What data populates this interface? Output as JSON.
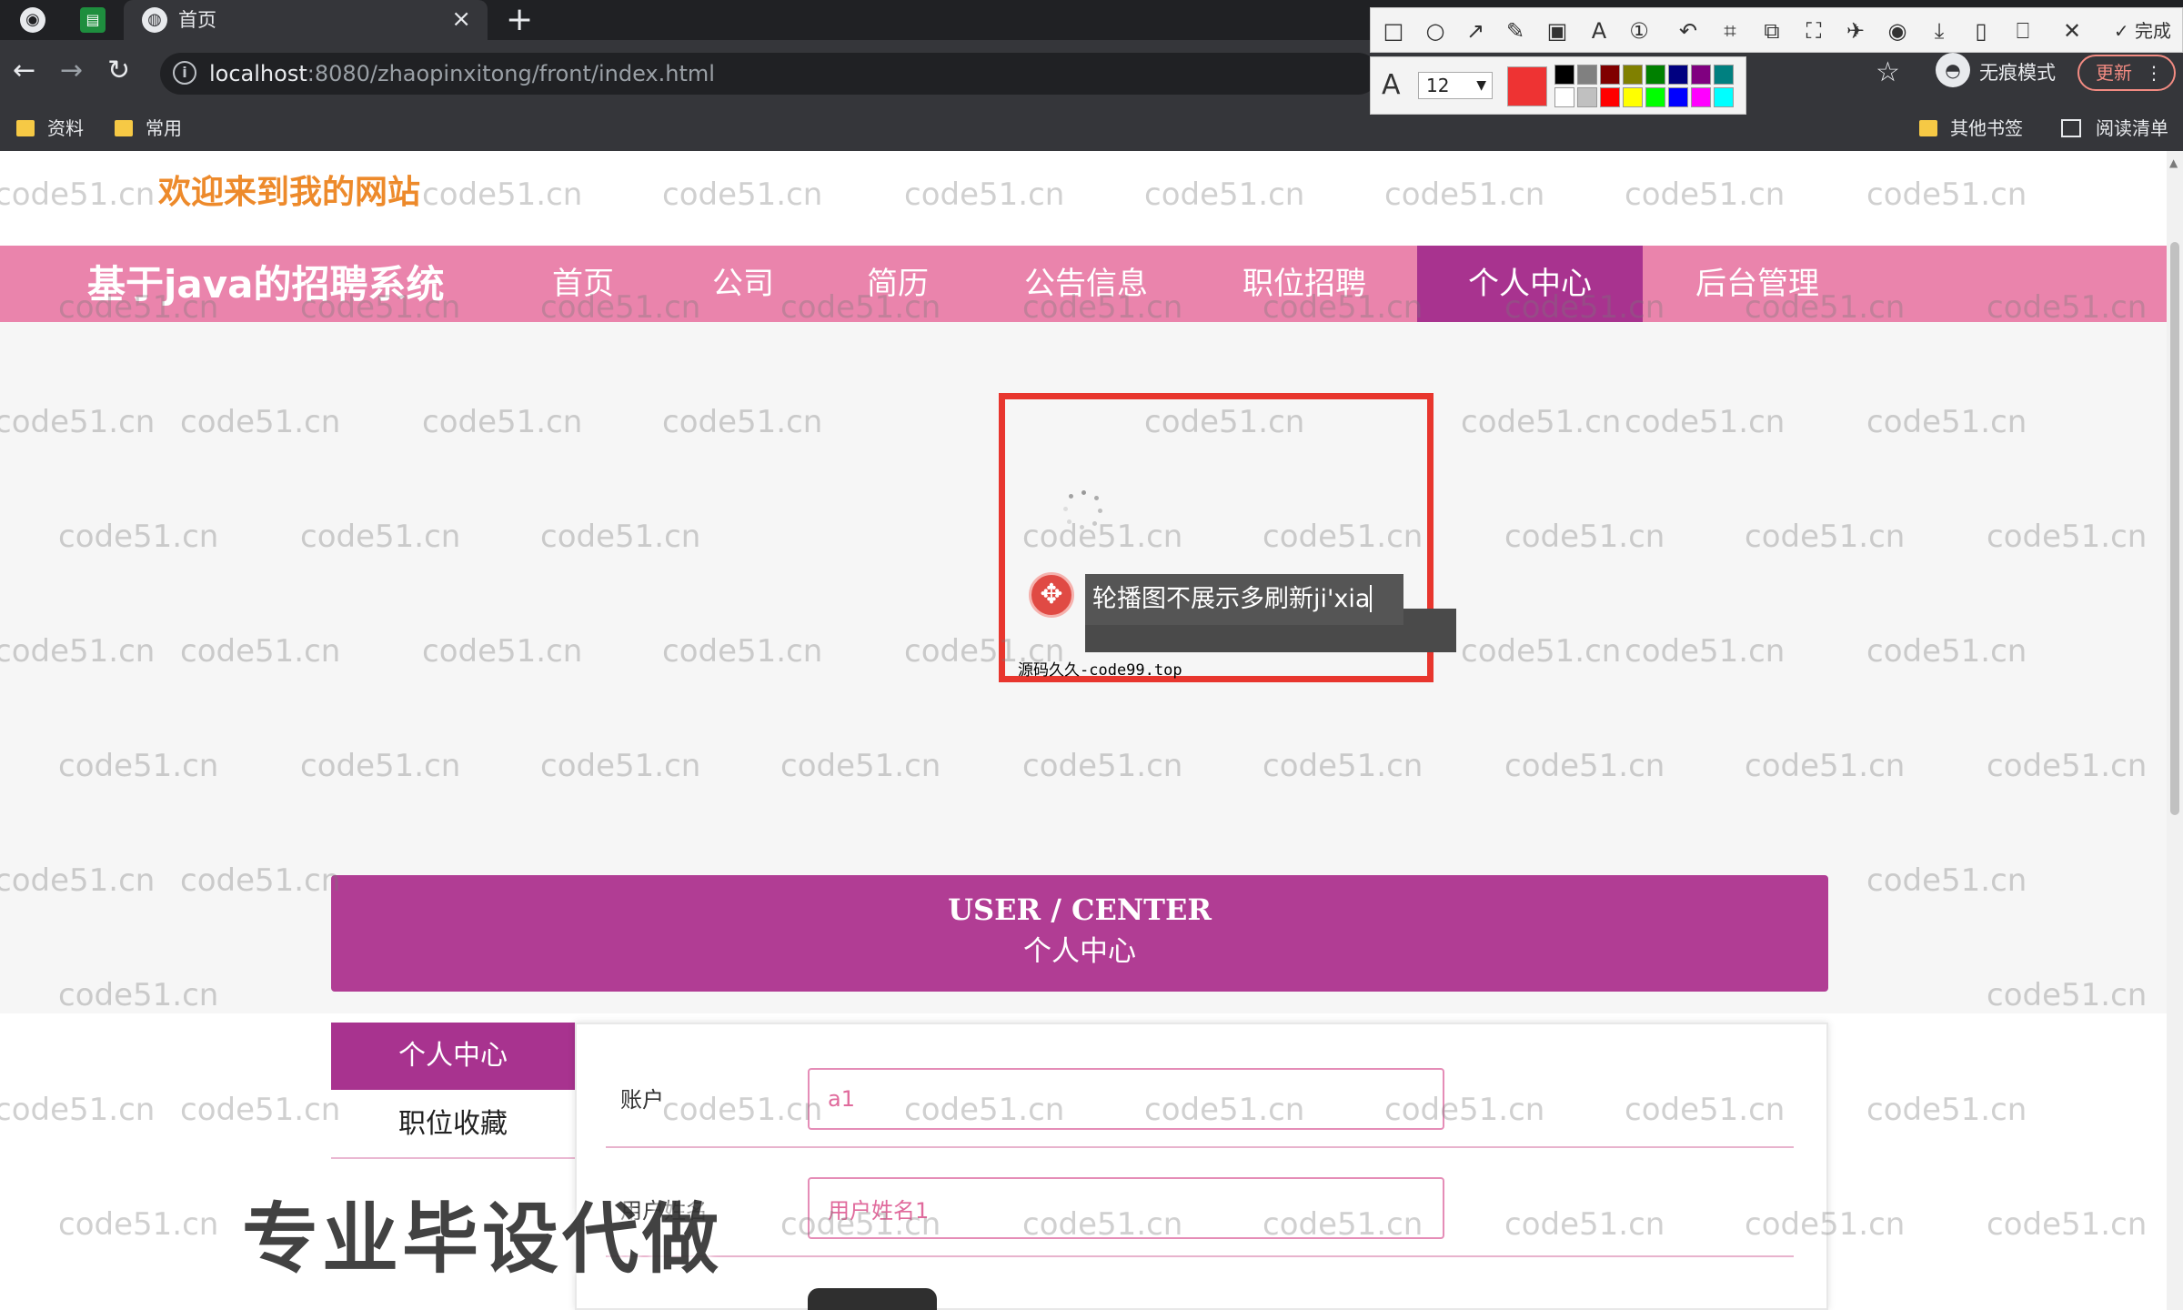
{
  "browser": {
    "tab_title": "首页",
    "tab_close": "×",
    "new_tab": "+",
    "url_host": "localhost",
    "url_rest": ":8080/zhaopinxitong/front/index.html",
    "incognito_label": "无痕模式",
    "update_label": "更新",
    "bookmarks": [
      "资料",
      "常用"
    ],
    "other_bookmarks": "其他书签",
    "reading_list": "阅读清单"
  },
  "snip_tool": {
    "done_label": "完成",
    "font_glyph": "A",
    "font_size": "12",
    "current_color": "#ee3333",
    "palette": [
      "#000000",
      "#808080",
      "#800000",
      "#808000",
      "#008000",
      "#000080",
      "#800080",
      "#008080",
      "#ffffff",
      "#c0c0c0",
      "#ff0000",
      "#ffff00",
      "#00ff00",
      "#0000ff",
      "#ff00ff",
      "#00ffff"
    ]
  },
  "header": {
    "welcome": "欢迎来到我的网站"
  },
  "nav": {
    "brand": "基于java的招聘系统",
    "items": [
      "首页",
      "公司",
      "简历",
      "公告信息",
      "职位招聘",
      "个人中心",
      "后台管理"
    ],
    "active_index": 5
  },
  "annotation": {
    "text": "轮播图不展示多刷新ji'xia",
    "stamp": "源码久久-code99.top"
  },
  "user_center": {
    "title_en": "USER / CENTER",
    "title_zh": "个人中心",
    "sidebar": [
      "个人中心",
      "职位收藏"
    ],
    "form": {
      "account_label": "账户",
      "account_value": "a1",
      "name_label": "用户姓名",
      "name_value": "用户姓名1"
    }
  },
  "overlay": {
    "promo": "专业毕设代做",
    "watermark": "code51.cn"
  },
  "colors": {
    "nav_bg": "#ea84ac",
    "nav_active": "#a8338f",
    "uc_header": "#b13d94",
    "welcome": "#ed8a2b",
    "annotation_border": "#e8362e"
  }
}
